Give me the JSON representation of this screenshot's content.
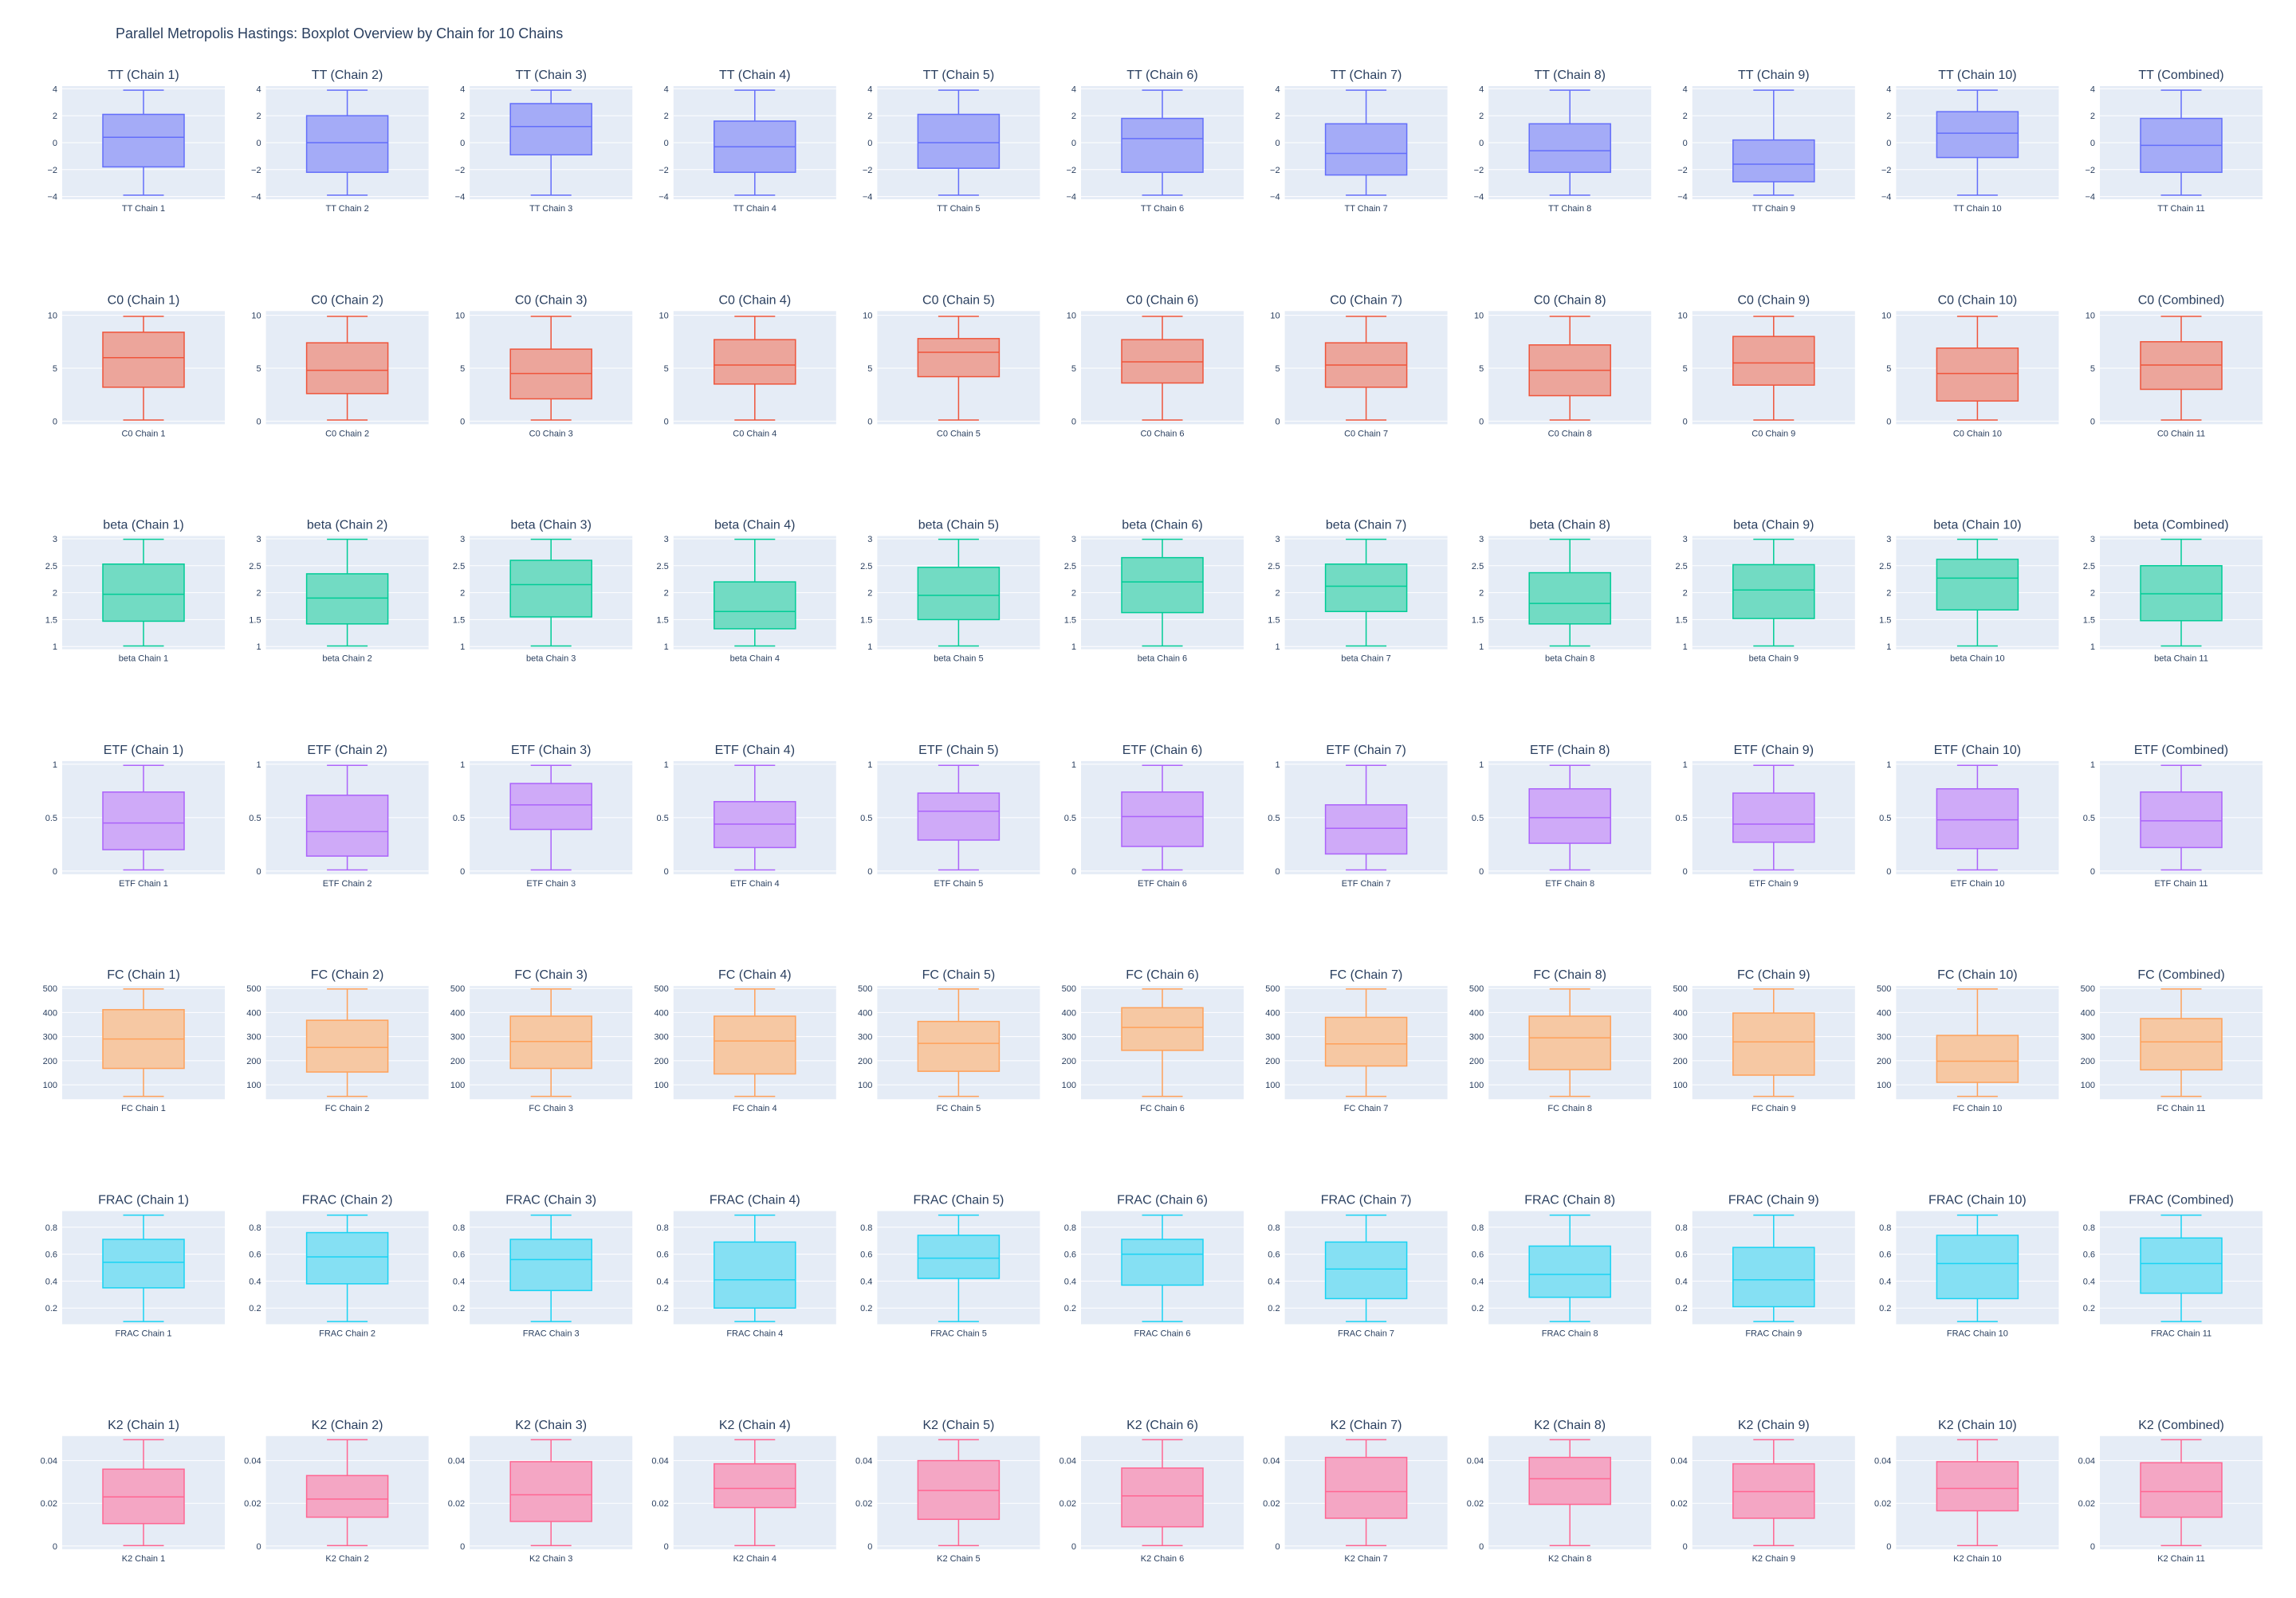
{
  "title": "Parallel Metropolis Hastings: Boxplot Overview by Chain for 10 Chains",
  "colors": {
    "TT": {
      "fill": "#a4abf7",
      "line": "#636efa"
    },
    "C0": {
      "fill": "#eca59b",
      "line": "#ef553b"
    },
    "beta": {
      "fill": "#72dbc3",
      "line": "#00cc96"
    },
    "ETF": {
      "fill": "#cfaaf8",
      "line": "#ab63fa"
    },
    "FC": {
      "fill": "#f6c8a3",
      "line": "#ffa15a"
    },
    "FRAC": {
      "fill": "#85e0f3",
      "line": "#19d3f3"
    },
    "K2": {
      "fill": "#f4a6c4",
      "line": "#ff6692"
    },
    "plot_bg": "#e5ecf6",
    "grid": "#ffffff",
    "text": "#2a3f5f"
  },
  "chart_data": [
    {
      "param": "TT",
      "type": "box",
      "ylim": [
        -4.2,
        4.2
      ],
      "yticks": [
        -4,
        -2,
        0,
        2,
        4
      ],
      "ytick_labels": [
        "−4",
        "−2",
        "0",
        "2",
        "4"
      ],
      "panels": [
        {
          "title": "TT (Chain 1)",
          "xlabel": "TT Chain 1",
          "min": -3.9,
          "q1": -1.8,
          "median": 0.4,
          "q3": 2.1,
          "max": 3.9
        },
        {
          "title": "TT (Chain 2)",
          "xlabel": "TT Chain 2",
          "min": -3.9,
          "q1": -2.2,
          "median": 0.0,
          "q3": 2.0,
          "max": 3.9
        },
        {
          "title": "TT (Chain 3)",
          "xlabel": "TT Chain 3",
          "min": -3.9,
          "q1": -0.9,
          "median": 1.2,
          "q3": 2.9,
          "max": 3.9
        },
        {
          "title": "TT (Chain 4)",
          "xlabel": "TT Chain 4",
          "min": -3.9,
          "q1": -2.2,
          "median": -0.3,
          "q3": 1.6,
          "max": 3.9
        },
        {
          "title": "TT (Chain 5)",
          "xlabel": "TT Chain 5",
          "min": -3.9,
          "q1": -1.9,
          "median": 0.0,
          "q3": 2.1,
          "max": 3.9
        },
        {
          "title": "TT (Chain 6)",
          "xlabel": "TT Chain 6",
          "min": -3.9,
          "q1": -2.2,
          "median": 0.3,
          "q3": 1.8,
          "max": 3.9
        },
        {
          "title": "TT (Chain 7)",
          "xlabel": "TT Chain 7",
          "min": -3.9,
          "q1": -2.4,
          "median": -0.8,
          "q3": 1.4,
          "max": 3.9
        },
        {
          "title": "TT (Chain 8)",
          "xlabel": "TT Chain 8",
          "min": -3.9,
          "q1": -2.2,
          "median": -0.6,
          "q3": 1.4,
          "max": 3.9
        },
        {
          "title": "TT (Chain 9)",
          "xlabel": "TT Chain 9",
          "min": -3.9,
          "q1": -2.9,
          "median": -1.6,
          "q3": 0.2,
          "max": 3.9
        },
        {
          "title": "TT (Chain 10)",
          "xlabel": "TT Chain 10",
          "min": -3.9,
          "q1": -1.1,
          "median": 0.7,
          "q3": 2.3,
          "max": 3.9
        },
        {
          "title": "TT (Combined)",
          "xlabel": "TT Chain 11",
          "min": -3.9,
          "q1": -2.2,
          "median": -0.2,
          "q3": 1.8,
          "max": 3.9
        }
      ]
    },
    {
      "param": "C0",
      "type": "box",
      "ylim": [
        -0.3,
        10.4
      ],
      "yticks": [
        0,
        5,
        10
      ],
      "ytick_labels": [
        "0",
        "5",
        "10"
      ],
      "panels": [
        {
          "title": "C0 (Chain 1)",
          "xlabel": "C0 Chain 1",
          "min": 0.1,
          "q1": 3.2,
          "median": 6.0,
          "q3": 8.4,
          "max": 9.9
        },
        {
          "title": "C0 (Chain 2)",
          "xlabel": "C0 Chain 2",
          "min": 0.1,
          "q1": 2.6,
          "median": 4.8,
          "q3": 7.4,
          "max": 9.9
        },
        {
          "title": "C0 (Chain 3)",
          "xlabel": "C0 Chain 3",
          "min": 0.1,
          "q1": 2.1,
          "median": 4.5,
          "q3": 6.8,
          "max": 9.9
        },
        {
          "title": "C0 (Chain 4)",
          "xlabel": "C0 Chain 4",
          "min": 0.1,
          "q1": 3.5,
          "median": 5.3,
          "q3": 7.7,
          "max": 9.9
        },
        {
          "title": "C0 (Chain 5)",
          "xlabel": "C0 Chain 5",
          "min": 0.1,
          "q1": 4.2,
          "median": 6.5,
          "q3": 7.8,
          "max": 9.9
        },
        {
          "title": "C0 (Chain 6)",
          "xlabel": "C0 Chain 6",
          "min": 0.1,
          "q1": 3.6,
          "median": 5.6,
          "q3": 7.7,
          "max": 9.9
        },
        {
          "title": "C0 (Chain 7)",
          "xlabel": "C0 Chain 7",
          "min": 0.1,
          "q1": 3.2,
          "median": 5.3,
          "q3": 7.4,
          "max": 9.9
        },
        {
          "title": "C0 (Chain 8)",
          "xlabel": "C0 Chain 8",
          "min": 0.1,
          "q1": 2.4,
          "median": 4.8,
          "q3": 7.2,
          "max": 9.9
        },
        {
          "title": "C0 (Chain 9)",
          "xlabel": "C0 Chain 9",
          "min": 0.1,
          "q1": 3.4,
          "median": 5.5,
          "q3": 8.0,
          "max": 9.9
        },
        {
          "title": "C0 (Chain 10)",
          "xlabel": "C0 Chain 10",
          "min": 0.1,
          "q1": 1.9,
          "median": 4.5,
          "q3": 6.9,
          "max": 9.9
        },
        {
          "title": "C0 (Combined)",
          "xlabel": "C0 Chain 11",
          "min": 0.1,
          "q1": 3.0,
          "median": 5.3,
          "q3": 7.5,
          "max": 9.9
        }
      ]
    },
    {
      "param": "beta",
      "type": "box",
      "ylim": [
        0.95,
        3.05
      ],
      "yticks": [
        1,
        1.5,
        2,
        2.5,
        3
      ],
      "ytick_labels": [
        "1",
        "1.5",
        "2",
        "2.5",
        "3"
      ],
      "panels": [
        {
          "title": "beta (Chain 1)",
          "xlabel": "beta Chain 1",
          "min": 1.01,
          "q1": 1.47,
          "median": 1.97,
          "q3": 2.53,
          "max": 2.99
        },
        {
          "title": "beta (Chain 2)",
          "xlabel": "beta Chain 2",
          "min": 1.01,
          "q1": 1.42,
          "median": 1.9,
          "q3": 2.35,
          "max": 2.99
        },
        {
          "title": "beta (Chain 3)",
          "xlabel": "beta Chain 3",
          "min": 1.01,
          "q1": 1.55,
          "median": 2.15,
          "q3": 2.6,
          "max": 2.99
        },
        {
          "title": "beta (Chain 4)",
          "xlabel": "beta Chain 4",
          "min": 1.01,
          "q1": 1.33,
          "median": 1.65,
          "q3": 2.2,
          "max": 2.99
        },
        {
          "title": "beta (Chain 5)",
          "xlabel": "beta Chain 5",
          "min": 1.01,
          "q1": 1.5,
          "median": 1.95,
          "q3": 2.47,
          "max": 2.99
        },
        {
          "title": "beta (Chain 6)",
          "xlabel": "beta Chain 6",
          "min": 1.01,
          "q1": 1.63,
          "median": 2.2,
          "q3": 2.65,
          "max": 2.99
        },
        {
          "title": "beta (Chain 7)",
          "xlabel": "beta Chain 7",
          "min": 1.01,
          "q1": 1.65,
          "median": 2.12,
          "q3": 2.53,
          "max": 2.99
        },
        {
          "title": "beta (Chain 8)",
          "xlabel": "beta Chain 8",
          "min": 1.01,
          "q1": 1.42,
          "median": 1.8,
          "q3": 2.37,
          "max": 2.99
        },
        {
          "title": "beta (Chain 9)",
          "xlabel": "beta Chain 9",
          "min": 1.01,
          "q1": 1.52,
          "median": 2.05,
          "q3": 2.52,
          "max": 2.99
        },
        {
          "title": "beta (Chain 10)",
          "xlabel": "beta Chain 10",
          "min": 1.01,
          "q1": 1.68,
          "median": 2.27,
          "q3": 2.62,
          "max": 2.99
        },
        {
          "title": "beta (Combined)",
          "xlabel": "beta Chain 11",
          "min": 1.01,
          "q1": 1.48,
          "median": 1.98,
          "q3": 2.5,
          "max": 2.99
        }
      ]
    },
    {
      "param": "ETF",
      "type": "box",
      "ylim": [
        -0.03,
        1.03
      ],
      "yticks": [
        0,
        0.5,
        1
      ],
      "ytick_labels": [
        "0",
        "0.5",
        "1"
      ],
      "panels": [
        {
          "title": "ETF (Chain 1)",
          "xlabel": "ETF Chain 1",
          "min": 0.01,
          "q1": 0.2,
          "median": 0.45,
          "q3": 0.74,
          "max": 0.99
        },
        {
          "title": "ETF (Chain 2)",
          "xlabel": "ETF Chain 2",
          "min": 0.01,
          "q1": 0.14,
          "median": 0.37,
          "q3": 0.71,
          "max": 0.99
        },
        {
          "title": "ETF (Chain 3)",
          "xlabel": "ETF Chain 3",
          "min": 0.01,
          "q1": 0.39,
          "median": 0.62,
          "q3": 0.82,
          "max": 0.99
        },
        {
          "title": "ETF (Chain 4)",
          "xlabel": "ETF Chain 4",
          "min": 0.01,
          "q1": 0.22,
          "median": 0.44,
          "q3": 0.65,
          "max": 0.99
        },
        {
          "title": "ETF (Chain 5)",
          "xlabel": "ETF Chain 5",
          "min": 0.01,
          "q1": 0.29,
          "median": 0.56,
          "q3": 0.73,
          "max": 0.99
        },
        {
          "title": "ETF (Chain 6)",
          "xlabel": "ETF Chain 6",
          "min": 0.01,
          "q1": 0.23,
          "median": 0.51,
          "q3": 0.74,
          "max": 0.99
        },
        {
          "title": "ETF (Chain 7)",
          "xlabel": "ETF Chain 7",
          "min": 0.01,
          "q1": 0.16,
          "median": 0.4,
          "q3": 0.62,
          "max": 0.99
        },
        {
          "title": "ETF (Chain 8)",
          "xlabel": "ETF Chain 8",
          "min": 0.01,
          "q1": 0.26,
          "median": 0.5,
          "q3": 0.77,
          "max": 0.99
        },
        {
          "title": "ETF (Chain 9)",
          "xlabel": "ETF Chain 9",
          "min": 0.01,
          "q1": 0.27,
          "median": 0.44,
          "q3": 0.73,
          "max": 0.99
        },
        {
          "title": "ETF (Chain 10)",
          "xlabel": "ETF Chain 10",
          "min": 0.01,
          "q1": 0.21,
          "median": 0.48,
          "q3": 0.77,
          "max": 0.99
        },
        {
          "title": "ETF (Combined)",
          "xlabel": "ETF Chain 11",
          "min": 0.01,
          "q1": 0.22,
          "median": 0.47,
          "q3": 0.74,
          "max": 0.99
        }
      ]
    },
    {
      "param": "FC",
      "type": "box",
      "ylim": [
        40,
        510
      ],
      "yticks": [
        100,
        200,
        300,
        400,
        500
      ],
      "ytick_labels": [
        "100",
        "200",
        "300",
        "400",
        "500"
      ],
      "panels": [
        {
          "title": "FC (Chain 1)",
          "xlabel": "FC Chain 1",
          "min": 52,
          "q1": 168,
          "median": 290,
          "q3": 412,
          "max": 498
        },
        {
          "title": "FC (Chain 2)",
          "xlabel": "FC Chain 2",
          "min": 52,
          "q1": 153,
          "median": 255,
          "q3": 368,
          "max": 498
        },
        {
          "title": "FC (Chain 3)",
          "xlabel": "FC Chain 3",
          "min": 52,
          "q1": 168,
          "median": 280,
          "q3": 385,
          "max": 498
        },
        {
          "title": "FC (Chain 4)",
          "xlabel": "FC Chain 4",
          "min": 52,
          "q1": 145,
          "median": 282,
          "q3": 385,
          "max": 498
        },
        {
          "title": "FC (Chain 5)",
          "xlabel": "FC Chain 5",
          "min": 52,
          "q1": 156,
          "median": 272,
          "q3": 363,
          "max": 498
        },
        {
          "title": "FC (Chain 6)",
          "xlabel": "FC Chain 6",
          "min": 52,
          "q1": 243,
          "median": 338,
          "q3": 420,
          "max": 498
        },
        {
          "title": "FC (Chain 7)",
          "xlabel": "FC Chain 7",
          "min": 52,
          "q1": 178,
          "median": 270,
          "q3": 380,
          "max": 498
        },
        {
          "title": "FC (Chain 8)",
          "xlabel": "FC Chain 8",
          "min": 52,
          "q1": 163,
          "median": 295,
          "q3": 385,
          "max": 498
        },
        {
          "title": "FC (Chain 9)",
          "xlabel": "FC Chain 9",
          "min": 52,
          "q1": 140,
          "median": 278,
          "q3": 398,
          "max": 498
        },
        {
          "title": "FC (Chain 10)",
          "xlabel": "FC Chain 10",
          "min": 52,
          "q1": 110,
          "median": 198,
          "q3": 305,
          "max": 498
        },
        {
          "title": "FC (Combined)",
          "xlabel": "FC Chain 11",
          "min": 52,
          "q1": 162,
          "median": 278,
          "q3": 375,
          "max": 498
        }
      ]
    },
    {
      "param": "FRAC",
      "type": "box",
      "ylim": [
        0.08,
        0.92
      ],
      "yticks": [
        0.2,
        0.4,
        0.6,
        0.8
      ],
      "ytick_labels": [
        "0.2",
        "0.4",
        "0.6",
        "0.8"
      ],
      "panels": [
        {
          "title": "FRAC (Chain 1)",
          "xlabel": "FRAC Chain 1",
          "min": 0.1,
          "q1": 0.35,
          "median": 0.54,
          "q3": 0.71,
          "max": 0.89
        },
        {
          "title": "FRAC (Chain 2)",
          "xlabel": "FRAC Chain 2",
          "min": 0.1,
          "q1": 0.38,
          "median": 0.58,
          "q3": 0.76,
          "max": 0.89
        },
        {
          "title": "FRAC (Chain 3)",
          "xlabel": "FRAC Chain 3",
          "min": 0.1,
          "q1": 0.33,
          "median": 0.56,
          "q3": 0.71,
          "max": 0.89
        },
        {
          "title": "FRAC (Chain 4)",
          "xlabel": "FRAC Chain 4",
          "min": 0.1,
          "q1": 0.2,
          "median": 0.41,
          "q3": 0.69,
          "max": 0.89
        },
        {
          "title": "FRAC (Chain 5)",
          "xlabel": "FRAC Chain 5",
          "min": 0.1,
          "q1": 0.42,
          "median": 0.57,
          "q3": 0.74,
          "max": 0.89
        },
        {
          "title": "FRAC (Chain 6)",
          "xlabel": "FRAC Chain 6",
          "min": 0.1,
          "q1": 0.37,
          "median": 0.6,
          "q3": 0.71,
          "max": 0.89
        },
        {
          "title": "FRAC (Chain 7)",
          "xlabel": "FRAC Chain 7",
          "min": 0.1,
          "q1": 0.27,
          "median": 0.49,
          "q3": 0.69,
          "max": 0.89
        },
        {
          "title": "FRAC (Chain 8)",
          "xlabel": "FRAC Chain 8",
          "min": 0.1,
          "q1": 0.28,
          "median": 0.45,
          "q3": 0.66,
          "max": 0.89
        },
        {
          "title": "FRAC (Chain 9)",
          "xlabel": "FRAC Chain 9",
          "min": 0.1,
          "q1": 0.21,
          "median": 0.41,
          "q3": 0.65,
          "max": 0.89
        },
        {
          "title": "FRAC (Chain 10)",
          "xlabel": "FRAC Chain 10",
          "min": 0.1,
          "q1": 0.27,
          "median": 0.53,
          "q3": 0.74,
          "max": 0.89
        },
        {
          "title": "FRAC (Combined)",
          "xlabel": "FRAC Chain 11",
          "min": 0.1,
          "q1": 0.31,
          "median": 0.53,
          "q3": 0.72,
          "max": 0.89
        }
      ]
    },
    {
      "param": "K2",
      "type": "box",
      "ylim": [
        -0.0015,
        0.0515
      ],
      "yticks": [
        0,
        0.02,
        0.04
      ],
      "ytick_labels": [
        "0",
        "0.02",
        "0.04"
      ],
      "panels": [
        {
          "title": "K2 (Chain 1)",
          "xlabel": "K2 Chain 1",
          "min": 0.0002,
          "q1": 0.0105,
          "median": 0.023,
          "q3": 0.036,
          "max": 0.0498
        },
        {
          "title": "K2 (Chain 2)",
          "xlabel": "K2 Chain 2",
          "min": 0.0002,
          "q1": 0.0135,
          "median": 0.022,
          "q3": 0.033,
          "max": 0.0498
        },
        {
          "title": "K2 (Chain 3)",
          "xlabel": "K2 Chain 3",
          "min": 0.0002,
          "q1": 0.0115,
          "median": 0.024,
          "q3": 0.0395,
          "max": 0.0498
        },
        {
          "title": "K2 (Chain 4)",
          "xlabel": "K2 Chain 4",
          "min": 0.0002,
          "q1": 0.018,
          "median": 0.027,
          "q3": 0.0385,
          "max": 0.0498
        },
        {
          "title": "K2 (Chain 5)",
          "xlabel": "K2 Chain 5",
          "min": 0.0002,
          "q1": 0.0125,
          "median": 0.026,
          "q3": 0.04,
          "max": 0.0498
        },
        {
          "title": "K2 (Chain 6)",
          "xlabel": "K2 Chain 6",
          "min": 0.0002,
          "q1": 0.009,
          "median": 0.0235,
          "q3": 0.0365,
          "max": 0.0498
        },
        {
          "title": "K2 (Chain 7)",
          "xlabel": "K2 Chain 7",
          "min": 0.0002,
          "q1": 0.013,
          "median": 0.0255,
          "q3": 0.0415,
          "max": 0.0498
        },
        {
          "title": "K2 (Chain 8)",
          "xlabel": "K2 Chain 8",
          "min": 0.0002,
          "q1": 0.0195,
          "median": 0.0315,
          "q3": 0.0415,
          "max": 0.0498
        },
        {
          "title": "K2 (Chain 9)",
          "xlabel": "K2 Chain 9",
          "min": 0.0002,
          "q1": 0.013,
          "median": 0.0255,
          "q3": 0.0385,
          "max": 0.0498
        },
        {
          "title": "K2 (Chain 10)",
          "xlabel": "K2 Chain 10",
          "min": 0.0002,
          "q1": 0.0165,
          "median": 0.027,
          "q3": 0.0395,
          "max": 0.0498
        },
        {
          "title": "K2 (Combined)",
          "xlabel": "K2 Chain 11",
          "min": 0.0002,
          "q1": 0.0135,
          "median": 0.0255,
          "q3": 0.039,
          "max": 0.0498
        }
      ]
    }
  ]
}
